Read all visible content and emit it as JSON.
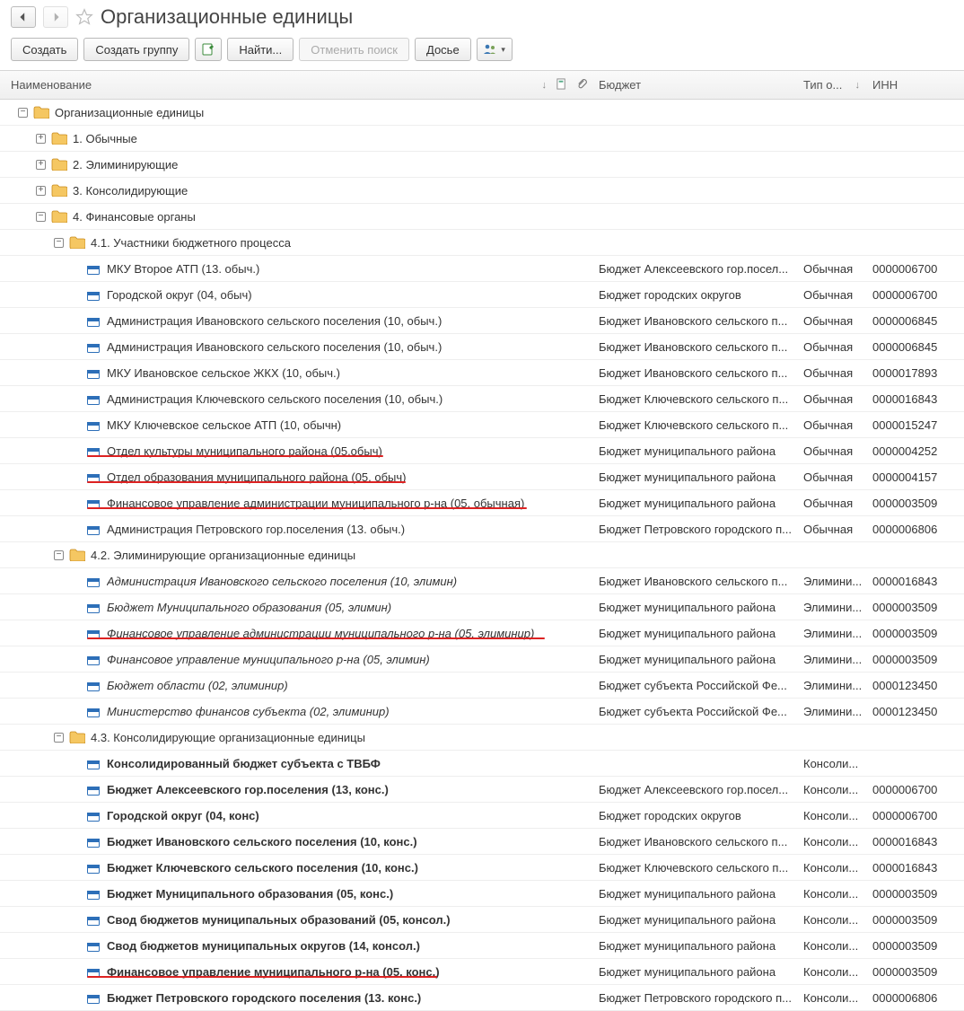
{
  "header": {
    "title": "Организационные единицы"
  },
  "toolbar": {
    "create": "Создать",
    "create_group": "Создать группу",
    "find": "Найти...",
    "cancel_find": "Отменить поиск",
    "dossier": "Досье"
  },
  "columns": {
    "name": "Наименование",
    "budget": "Бюджет",
    "type": "Тип о...",
    "inn": "ИНН"
  },
  "icons": {
    "arrow_down": "↓",
    "plus": "+",
    "minus": "−"
  },
  "rows": [
    {
      "indent": 0,
      "kind": "folder",
      "exp": "minus",
      "name": "Организационные единицы"
    },
    {
      "indent": 1,
      "kind": "folder",
      "exp": "plus",
      "name": "1. Обычные"
    },
    {
      "indent": 1,
      "kind": "folder",
      "exp": "plus",
      "name": "2. Элиминирующие"
    },
    {
      "indent": 1,
      "kind": "folder",
      "exp": "plus",
      "name": "3. Консолидирующие"
    },
    {
      "indent": 1,
      "kind": "folder",
      "exp": "minus",
      "name": "4. Финансовые органы"
    },
    {
      "indent": 2,
      "kind": "folder",
      "exp": "minus",
      "name": "4.1. Участники бюджетного процесса"
    },
    {
      "indent": 3,
      "kind": "item",
      "name": "МКУ Второе АТП (13. обыч.)",
      "budget": "Бюджет Алексеевского гор.посел...",
      "type": "Обычная",
      "inn": "0000006700"
    },
    {
      "indent": 3,
      "kind": "item",
      "name": "Городской округ (04, обыч)",
      "budget": "Бюджет городских округов",
      "type": "Обычная",
      "inn": "0000006700"
    },
    {
      "indent": 3,
      "kind": "item",
      "name": "Администрация Ивановского сельского поселения (10, обыч.)",
      "budget": "Бюджет Ивановского сельского п...",
      "type": "Обычная",
      "inn": "0000006845"
    },
    {
      "indent": 3,
      "kind": "item",
      "name": "Администрация Ивановского сельского поселения (10, обыч.)",
      "budget": "Бюджет Ивановского сельского п...",
      "type": "Обычная",
      "inn": "0000006845"
    },
    {
      "indent": 3,
      "kind": "item",
      "name": "МКУ  Ивановское сельское ЖКХ (10, обыч.)",
      "budget": "Бюджет Ивановского сельского п...",
      "type": "Обычная",
      "inn": "0000017893"
    },
    {
      "indent": 3,
      "kind": "item",
      "name": "Администрация Ключевского сельского поселения (10, обыч.)",
      "budget": "Бюджет Ключевского сельского п...",
      "type": "Обычная",
      "inn": "0000016843"
    },
    {
      "indent": 3,
      "kind": "item",
      "name": "МКУ Ключевское сельское АТП (10, обычн)",
      "budget": "Бюджет Ключевского сельского п...",
      "type": "Обычная",
      "inn": "0000015247"
    },
    {
      "indent": 3,
      "kind": "item",
      "name": "Отдел культуры муниципального района (05.обыч)",
      "budget": "Бюджет муниципального района",
      "type": "Обычная",
      "inn": "0000004252",
      "red": true,
      "red_w": 330
    },
    {
      "indent": 3,
      "kind": "item",
      "name": "Отдел образования муниципального района (05, обыч)",
      "budget": "Бюджет муниципального района",
      "type": "Обычная",
      "inn": "0000004157",
      "red": true,
      "red_w": 355
    },
    {
      "indent": 3,
      "kind": "item",
      "name": "Финансовое управление администрации муниципального р-на (05, обычная)",
      "budget": "Бюджет муниципального района",
      "type": "Обычная",
      "inn": "0000003509",
      "red": true,
      "red_w": 490
    },
    {
      "indent": 3,
      "kind": "item",
      "name": "Администрация Петровского гор.поселения (13. обыч.)",
      "budget": "Бюджет Петровского городского п...",
      "type": "Обычная",
      "inn": "0000006806"
    },
    {
      "indent": 2,
      "kind": "folder",
      "exp": "minus",
      "name": "4.2. Элиминирующие организационные единицы"
    },
    {
      "indent": 3,
      "kind": "item",
      "style": "italic",
      "name": "Администрация Ивановского сельского поселения (10, элимин)",
      "budget": "Бюджет Ивановского сельского п...",
      "type": "Элимини...",
      "inn": "0000016843"
    },
    {
      "indent": 3,
      "kind": "item",
      "style": "italic",
      "name": "Бюджет Муниципального образования (05, элимин)",
      "budget": "Бюджет муниципального района",
      "type": "Элимини...",
      "inn": "0000003509"
    },
    {
      "indent": 3,
      "kind": "item",
      "style": "italic",
      "name": "Финансовое управление администрации муниципального р-на (05, элиминир)",
      "budget": "Бюджет муниципального района",
      "type": "Элимини...",
      "inn": "0000003509",
      "red": true,
      "red_w": 510
    },
    {
      "indent": 3,
      "kind": "item",
      "style": "italic",
      "name": "Финансовое управление муниципального р-на (05, элимин)",
      "budget": "Бюджет муниципального района",
      "type": "Элимини...",
      "inn": "0000003509"
    },
    {
      "indent": 3,
      "kind": "item",
      "style": "italic",
      "name": "Бюджет области (02, элиминир)",
      "budget": "Бюджет субъекта Российской Фе...",
      "type": "Элимини...",
      "inn": "0000123450"
    },
    {
      "indent": 3,
      "kind": "item",
      "style": "italic",
      "name": "Министерство финансов субъекта (02, элиминир)",
      "budget": "Бюджет субъекта Российской Фе...",
      "type": "Элимини...",
      "inn": "0000123450"
    },
    {
      "indent": 2,
      "kind": "folder",
      "exp": "minus",
      "name": "4.3. Консолидирующие организационные единицы"
    },
    {
      "indent": 3,
      "kind": "item",
      "style": "bold",
      "name": "Консолидированный бюджет субъекта с ТВБФ",
      "budget": "",
      "type": "Консоли...",
      "inn": ""
    },
    {
      "indent": 3,
      "kind": "item",
      "style": "bold",
      "name": "Бюджет Алексеевского гор.поселения (13, конс.)",
      "budget": "Бюджет Алексеевского гор.посел...",
      "type": "Консоли...",
      "inn": "0000006700"
    },
    {
      "indent": 3,
      "kind": "item",
      "style": "bold",
      "name": "Городской округ (04, конс)",
      "budget": "Бюджет городских округов",
      "type": "Консоли...",
      "inn": "0000006700"
    },
    {
      "indent": 3,
      "kind": "item",
      "style": "bold",
      "name": "Бюджет Ивановского сельского поселения (10, конс.)",
      "budget": "Бюджет Ивановского сельского п...",
      "type": "Консоли...",
      "inn": "0000016843"
    },
    {
      "indent": 3,
      "kind": "item",
      "style": "bold",
      "name": "Бюджет Ключевского сельского поселения (10, конс.)",
      "budget": "Бюджет Ключевского сельского п...",
      "type": "Консоли...",
      "inn": "0000016843"
    },
    {
      "indent": 3,
      "kind": "item",
      "style": "bold",
      "name": "Бюджет Муниципального образования  (05, конс.)",
      "budget": "Бюджет муниципального района",
      "type": "Консоли...",
      "inn": "0000003509"
    },
    {
      "indent": 3,
      "kind": "item",
      "style": "bold",
      "name": "Свод бюджетов муниципальных образований (05, консол.)",
      "budget": "Бюджет муниципального района",
      "type": "Консоли...",
      "inn": "0000003509"
    },
    {
      "indent": 3,
      "kind": "item",
      "style": "bold",
      "name": "Свод бюджетов муниципальных округов (14, консол.)",
      "budget": "Бюджет муниципального района",
      "type": "Консоли...",
      "inn": "0000003509"
    },
    {
      "indent": 3,
      "kind": "item",
      "style": "bold",
      "name": "Финансовое управление муниципального р-на (05, конс.)",
      "budget": "Бюджет муниципального района",
      "type": "Консоли...",
      "inn": "0000003509",
      "red": true,
      "red_w": 390
    },
    {
      "indent": 3,
      "kind": "item",
      "style": "bold",
      "name": "Бюджет Петровского городского поселения (13. конс.)",
      "budget": "Бюджет Петровского городского п...",
      "type": "Консоли...",
      "inn": "0000006806"
    }
  ]
}
